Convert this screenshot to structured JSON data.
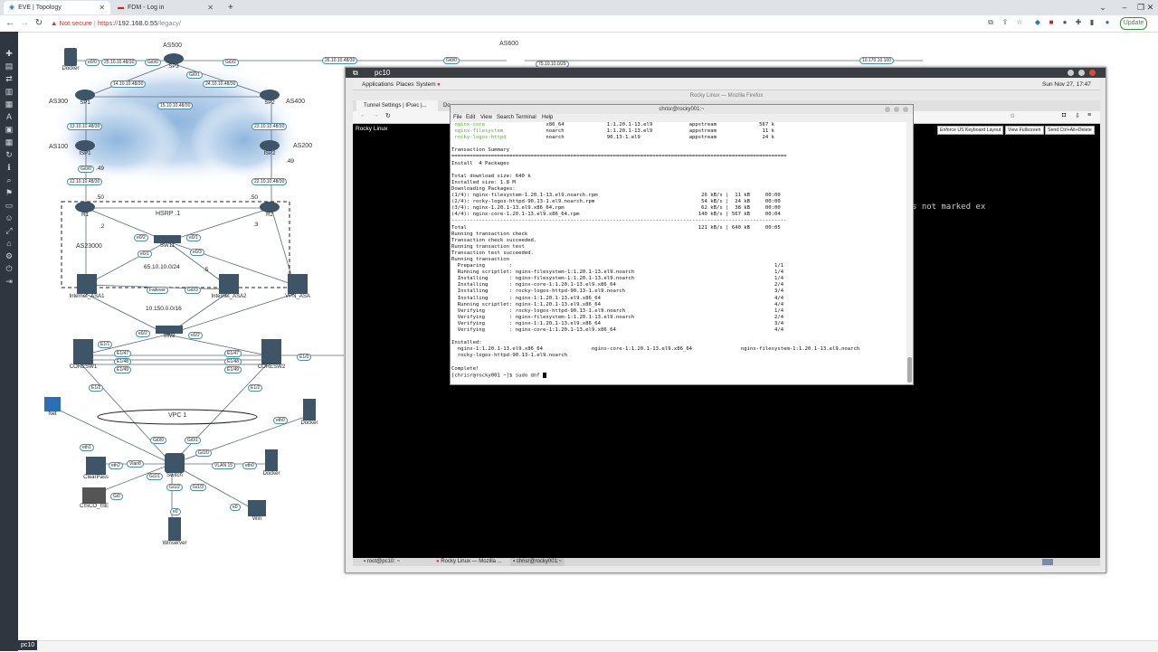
{
  "browser": {
    "tabs": [
      {
        "label": "EVE | Topology"
      },
      {
        "label": "FDM - Log in"
      }
    ],
    "new_tab": "+",
    "security_label": "Not secure",
    "url_scheme": "https://",
    "url_host": "192.168.0.55",
    "url_path": "/legacy/",
    "update_label": "Update"
  },
  "topology": {
    "as_labels": [
      "AS500",
      "AS600",
      "AS300",
      "AS400",
      "AS100",
      "AS200",
      "AS23000"
    ],
    "hsrp": "HSRP .1",
    "vpc": "VPC 1",
    "networks": {
      "lan": "65.10.10.0/24",
      "inside": "10.150.0.0/16"
    },
    "nodes": [
      "Docker",
      "SP3",
      "SP1",
      "SP2",
      "ISP1",
      "ISP2",
      "R1",
      "R2",
      "SW11",
      "Internet_ASA1",
      "Internet_ASA2",
      "VPN_ASA",
      "SW8",
      "CORESW1",
      "CORESW2",
      "Net",
      "Docker",
      "ClearPass",
      "Switch",
      "Docker",
      "CISCO_ISE",
      "Win",
      "Winserver"
    ],
    "interfaces": [
      "e0/0",
      "25.10.10.48/30",
      "Gi0/0",
      "Gi0/1",
      "Gi0/2",
      "26.10.10.48/30",
      "14.10.10.48/30",
      "24.10.10.48/30",
      "15.10.10.48/30",
      "13.10.10.48/30",
      "23.10.10.48/30",
      "Gi0/0",
      ".49",
      "12.10.10.48/30",
      "22.10.10.48/30",
      ".50",
      "e0/1",
      "e0/2",
      "e0/3",
      "Failover",
      "Gi0/3",
      "E1/1",
      "E1/47",
      "E1/48",
      "E1/49",
      "E1/0",
      "E1/2",
      "eth0",
      "eth1",
      "eth2",
      "Vlan8",
      "VLAN 15",
      "Gi1/1",
      "Gi1/0",
      "Gi1/2",
      "Gi1/3",
      "e0",
      "Gi0",
      "75.10.10.0/29",
      "10.170.10.100"
    ],
    "hosts": {
      ".1": ".1",
      ".2": ".2",
      ".3": ".3",
      ".5": ".5"
    }
  },
  "pc10": {
    "title": "pc10",
    "gnome_menu": [
      "Applications",
      "Places",
      "System"
    ],
    "clock": "Sun Nov 27, 17:47",
    "firefox_title": "Rocky Linux — Mozilla Firefox",
    "firefox_tabs": [
      "Tunnel Settings | IPsec |...",
      "Do"
    ],
    "page_title": "Rocky Linux",
    "vnc_buttons": [
      "Enforce US Keyboard Layout",
      "View Fullscreen",
      "Send Ctrl+Alt+Delete"
    ],
    "background_text": "s not marked ex",
    "taskbar": [
      "root@pc10: ~",
      "Rocky Linux — Mozilla ...",
      "chrisr@rocky001:~"
    ]
  },
  "terminal": {
    "title": "chrisr@rocky001:~",
    "menu": [
      "File",
      "Edit",
      "View",
      "Search",
      "Terminal",
      "Help"
    ],
    "lines": [
      {
        "t": " nginx-core                    x86_64              1:1.20.1-13.el9            appstream              567 k",
        "c": "grn-partial"
      },
      {
        "t": " nginx-filesystem              noarch              1:1.20.1-13.el9            appstream               11 k",
        "c": "grn-partial"
      },
      {
        "t": " rocky-logos-httpd             noarch              90.13-1.el9                appstream               24 k",
        "c": "grn-partial"
      },
      {
        "t": "",
        "c": ""
      },
      {
        "t": "Transaction Summary",
        "c": ""
      },
      {
        "t": "==============================================================================================================",
        "c": ""
      },
      {
        "t": "Install  4 Packages",
        "c": ""
      },
      {
        "t": "",
        "c": ""
      },
      {
        "t": "Total download size: 640 k",
        "c": ""
      },
      {
        "t": "Installed size: 1.8 M",
        "c": ""
      },
      {
        "t": "Downloading Packages:",
        "c": ""
      },
      {
        "t": "(1/4): nginx-filesystem-1.20.1-13.el9.noarch.rpm                                  26 kB/s |  11 kB     00:00",
        "c": ""
      },
      {
        "t": "(2/4): rocky-logos-httpd-90.13-1.el9.noarch.rpm                                   54 kB/s |  24 kB     00:00",
        "c": ""
      },
      {
        "t": "(3/4): nginx-1.20.1-13.el9.x86_64.rpm                                             62 kB/s |  38 kB     00:00",
        "c": ""
      },
      {
        "t": "(4/4): nginx-core-1.20.1-13.el9.x86_64.rpm                                       140 kB/s | 567 kB     00:04",
        "c": ""
      },
      {
        "t": "--------------------------------------------------------------------------------------------------------------",
        "c": ""
      },
      {
        "t": "Total                                                                            121 kB/s | 640 kB     00:05",
        "c": ""
      },
      {
        "t": "Running transaction check",
        "c": ""
      },
      {
        "t": "Transaction check succeeded.",
        "c": ""
      },
      {
        "t": "Running transaction test",
        "c": ""
      },
      {
        "t": "Transaction test succeeded.",
        "c": ""
      },
      {
        "t": "Running transaction",
        "c": ""
      },
      {
        "t": "  Preparing        :                                                                                      1/1",
        "c": ""
      },
      {
        "t": "  Running scriptlet: nginx-filesystem-1:1.20.1-13.el9.noarch                                              1/4",
        "c": ""
      },
      {
        "t": "  Installing       : nginx-filesystem-1:1.20.1-13.el9.noarch                                              1/4",
        "c": ""
      },
      {
        "t": "  Installing       : nginx-core-1:1.20.1-13.el9.x86_64                                                    2/4",
        "c": ""
      },
      {
        "t": "  Installing       : rocky-logos-httpd-90.13-1.el9.noarch                                                 3/4",
        "c": ""
      },
      {
        "t": "  Installing       : nginx-1:1.20.1-13.el9.x86_64                                                         4/4",
        "c": ""
      },
      {
        "t": "  Running scriptlet: nginx-1:1.20.1-13.el9.x86_64                                                         4/4",
        "c": ""
      },
      {
        "t": "  Verifying        : rocky-logos-httpd-90.13-1.el9.noarch                                                 1/4",
        "c": ""
      },
      {
        "t": "  Verifying        : nginx-filesystem-1:1.20.1-13.el9.noarch                                              2/4",
        "c": ""
      },
      {
        "t": "  Verifying        : nginx-1:1.20.1-13.el9.x86_64                                                         3/4",
        "c": ""
      },
      {
        "t": "  Verifying        : nginx-core-1:1.20.1-13.el9.x86_64                                                    4/4",
        "c": ""
      },
      {
        "t": "",
        "c": ""
      },
      {
        "t": "Installed:",
        "c": ""
      },
      {
        "t": "  nginx-1:1.20.1-13.el9.x86_64                nginx-core-1:1.20.1-13.el9.x86_64                nginx-filesystem-1:1.20.1-13.el9.noarch",
        "c": ""
      },
      {
        "t": "  rocky-logos-httpd-90.13-1.el9.noarch",
        "c": ""
      },
      {
        "t": "",
        "c": ""
      },
      {
        "t": "Complete!",
        "c": ""
      },
      {
        "t": "[chrisr@rocky001 ~]$ sudo dnf ",
        "c": "prompt"
      }
    ]
  },
  "eve": {
    "bottom_tab": "pc10"
  },
  "colors": {
    "sidebar": "#2f3640",
    "interface_border": "#4a90a4",
    "terminal_green": "#5aaa3a"
  }
}
